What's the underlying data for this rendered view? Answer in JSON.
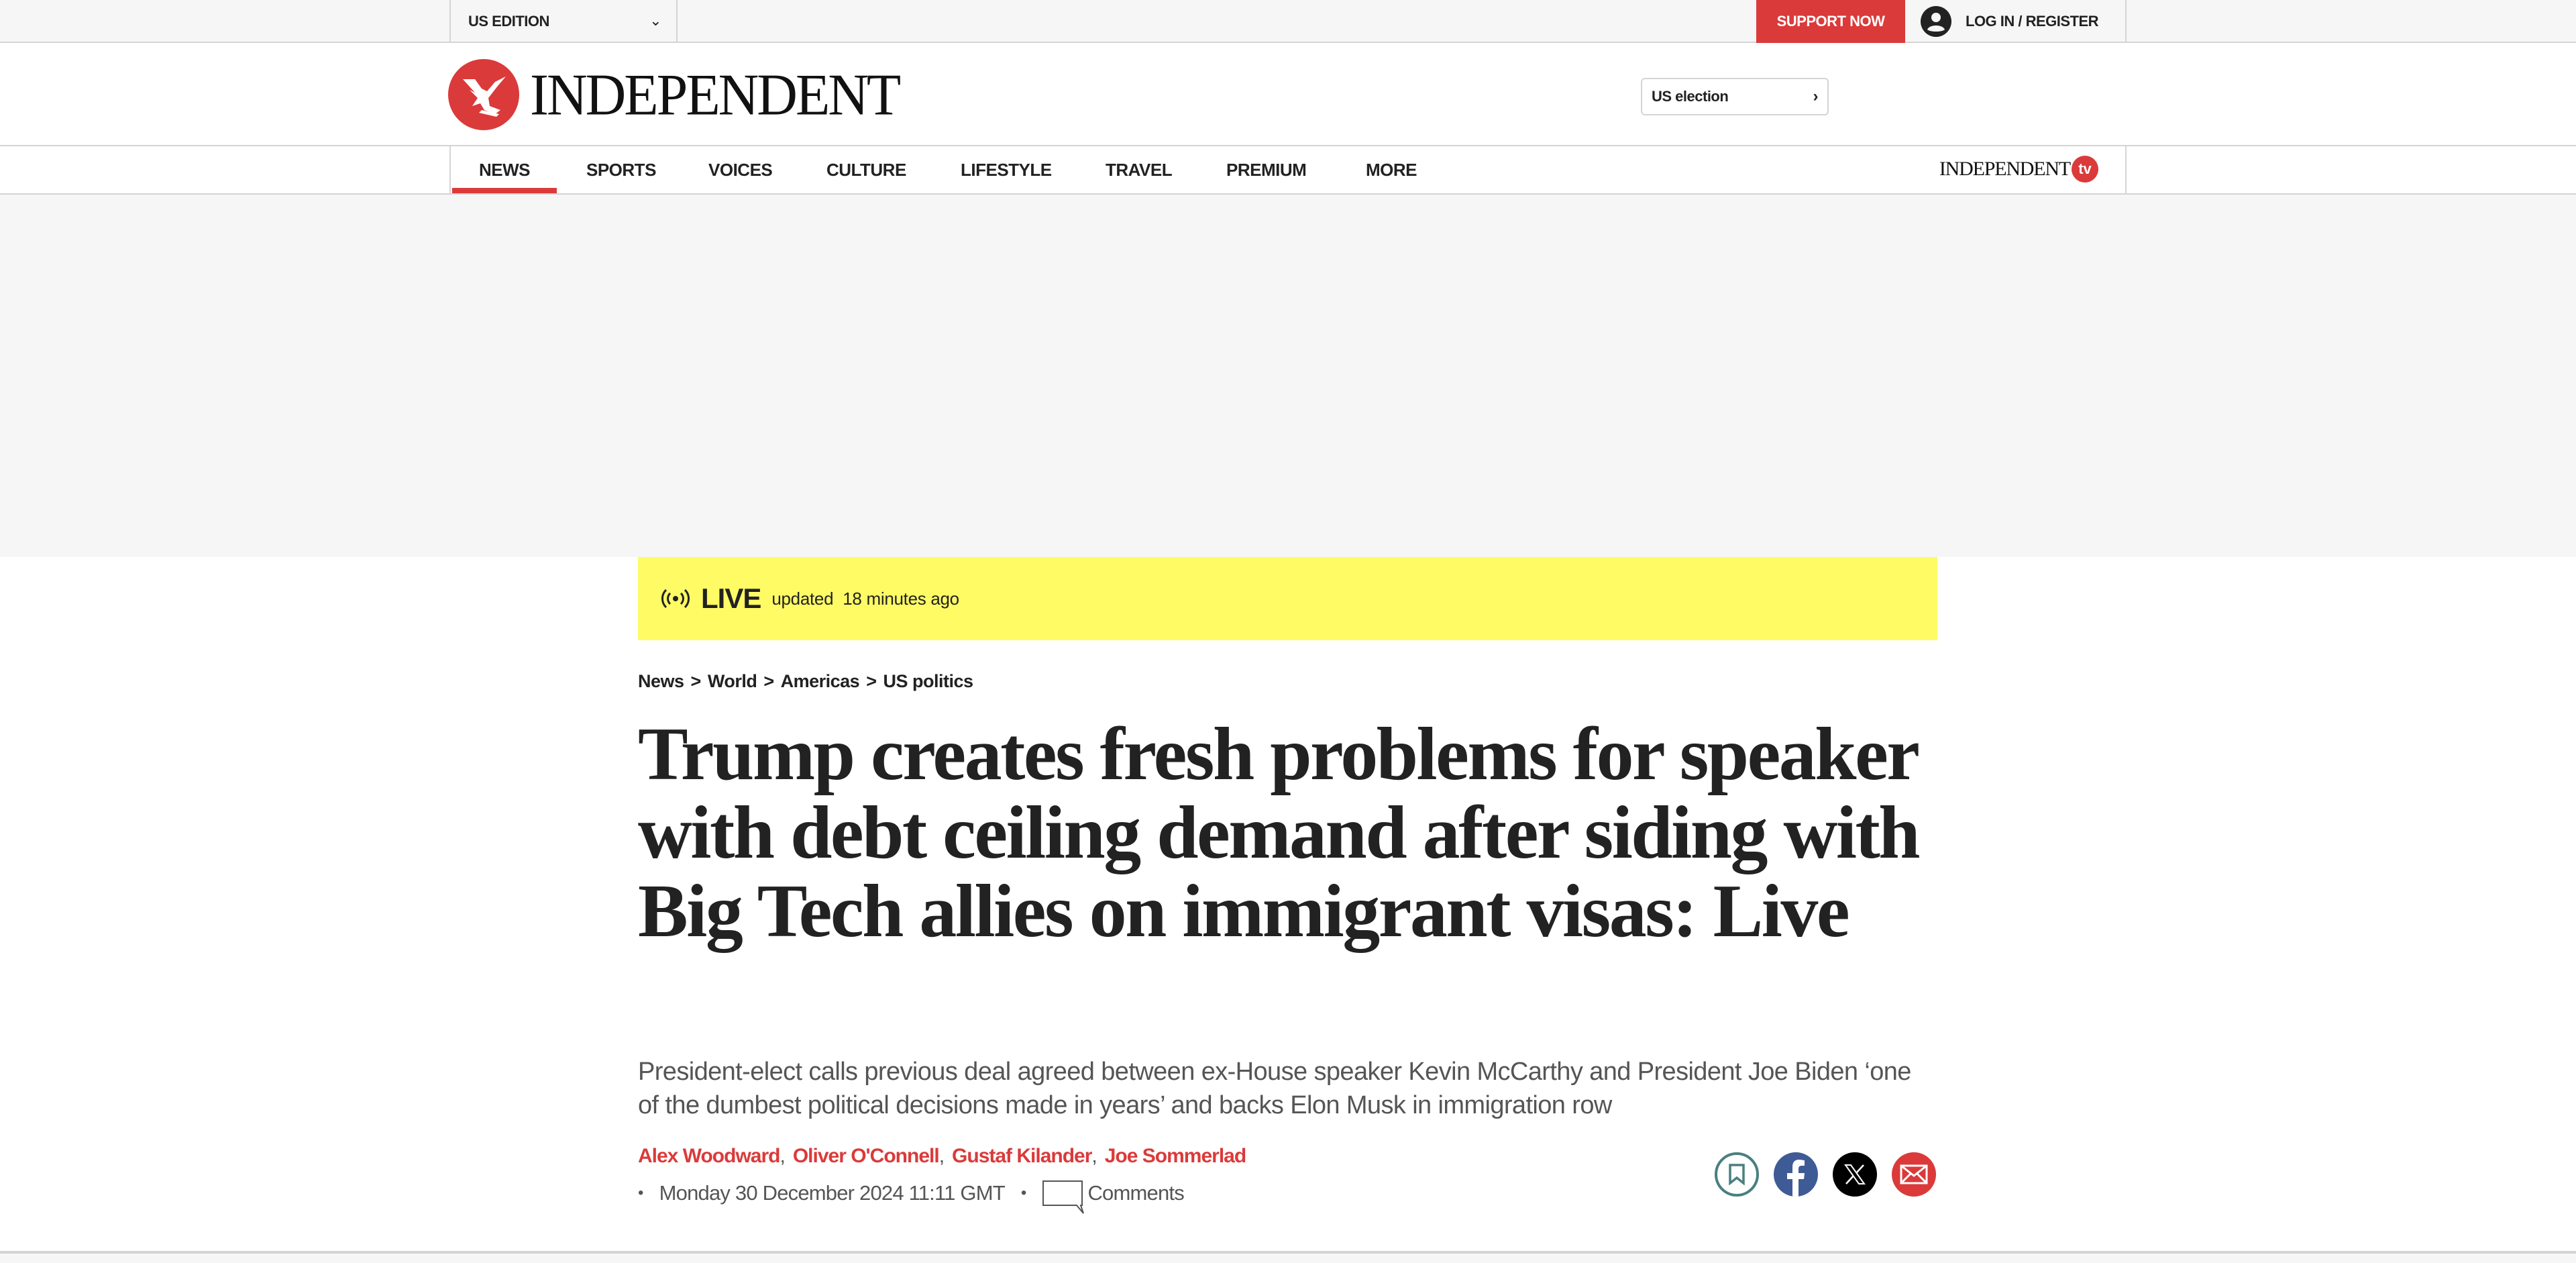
{
  "topbar": {
    "edition_label": "US EDITION",
    "support_label": "SUPPORT NOW",
    "login_label": "LOG IN / REGISTER"
  },
  "masthead": {
    "brand": "INDEPENDENT",
    "us_election_label": "US election"
  },
  "nav": {
    "items": [
      {
        "label": "NEWS",
        "active": true
      },
      {
        "label": "SPORTS"
      },
      {
        "label": "VOICES"
      },
      {
        "label": "CULTURE"
      },
      {
        "label": "LIFESTYLE"
      },
      {
        "label": "TRAVEL"
      },
      {
        "label": "PREMIUM"
      },
      {
        "label": "MORE"
      }
    ],
    "tv_brand": "INDEPENDENT",
    "tv_badge": "tv"
  },
  "live": {
    "label": "LIVE",
    "updated": "updated",
    "ago": "18 minutes ago"
  },
  "breadcrumb": [
    "News",
    "World",
    "Americas",
    "US politics"
  ],
  "breadcrumb_separator": ">",
  "article": {
    "headline": "Trump creates fresh problems for speaker with debt ceiling demand after siding with Big Tech allies on immigrant visas: Live",
    "standfirst": "President-elect calls previous deal agreed between ex-House speaker Kevin McCarthy and President Joe Biden ‘one of the dumbest political decisions made in years’ and backs Elon Musk in immigration row",
    "authors": [
      "Alex Woodward",
      "Oliver O'Connell",
      "Gustaf Kilander",
      "Joe Sommerlad"
    ],
    "date": "Monday 30 December 2024 11:11 GMT",
    "comments_label": "Comments"
  },
  "colors": {
    "brand_red": "#db3a3a",
    "live_yellow": "#fffb64",
    "bookmark_teal": "#4a7f80",
    "facebook_blue": "#3f5b96"
  }
}
